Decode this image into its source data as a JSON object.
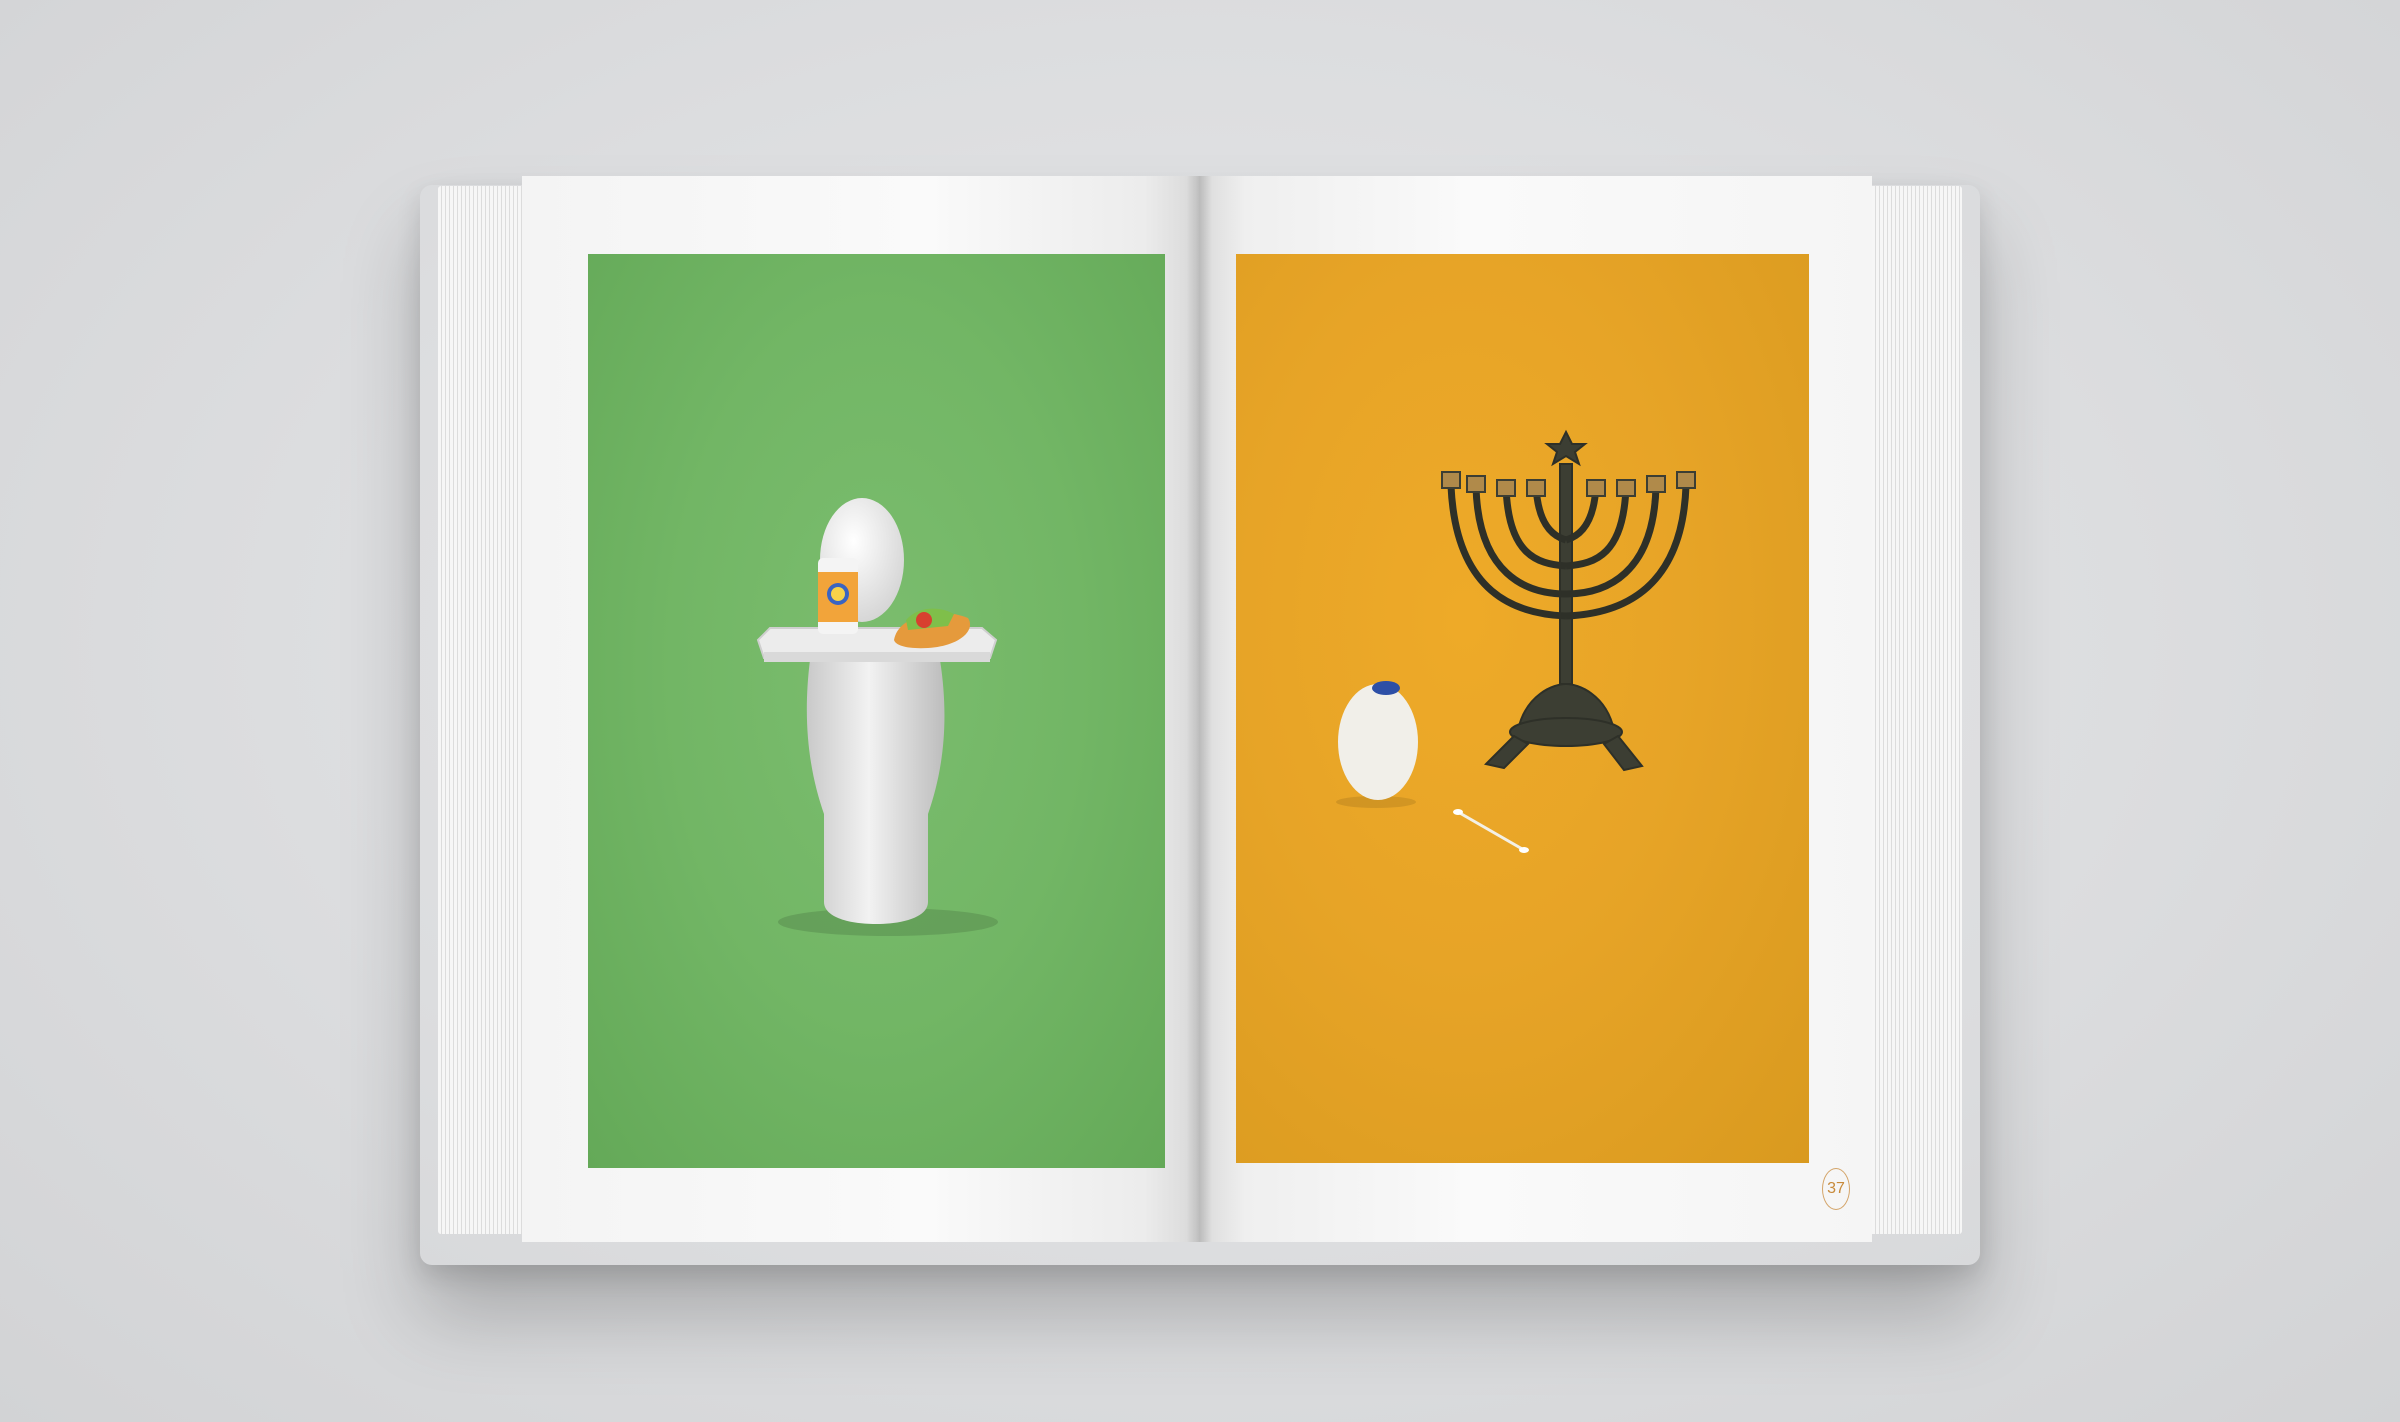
{
  "spread": {
    "right_page_number": "37"
  },
  "left_page": {
    "photo_background": "#72b665"
  },
  "right_page": {
    "photo_background": "#e7a427",
    "page_number_color": "#c88a3a"
  }
}
